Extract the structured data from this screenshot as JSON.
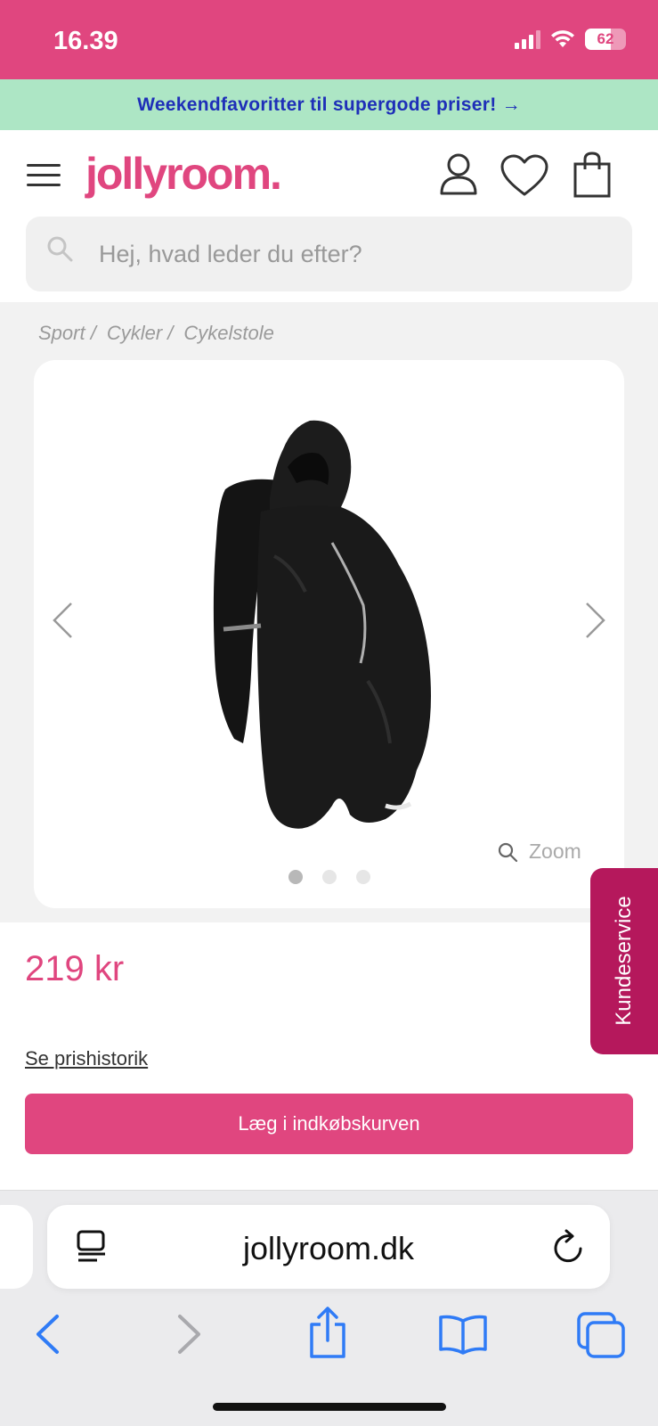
{
  "status_bar": {
    "time": "16.39",
    "battery": "62",
    "battery_level": 0.62
  },
  "promo": {
    "text": "Weekendfavoritter til supergode priser! →"
  },
  "header": {
    "logo": "jollyroom."
  },
  "search": {
    "placeholder": "Hej, hvad leder du efter?"
  },
  "breadcrumb": [
    "Sport /",
    "Cykler /",
    "Cykelstole"
  ],
  "gallery": {
    "zoom_label": "Zoom",
    "image_count": 3,
    "active_index": 0
  },
  "product": {
    "price": "219 kr",
    "price_history_link": "Se prishistorik",
    "add_to_cart": "Læg i indkøbskurven"
  },
  "kundeservice": {
    "label": "Kundeservice"
  },
  "browser": {
    "url": "jollyroom.dk"
  },
  "colors": {
    "brand_pink": "#e0467f",
    "promo_green": "#ade6c5",
    "promo_text": "#1e2fb8",
    "kundeservice": "#b5185c",
    "ios_blue": "#2f7bf6"
  },
  "icons": [
    "hamburger-icon",
    "user-icon",
    "heart-icon",
    "bag-icon",
    "search-icon",
    "chevron-left-icon",
    "chevron-right-icon",
    "zoom-icon",
    "reader-icon",
    "reload-icon",
    "back-icon",
    "forward-icon",
    "share-icon",
    "bookmarks-icon",
    "tabs-icon"
  ]
}
